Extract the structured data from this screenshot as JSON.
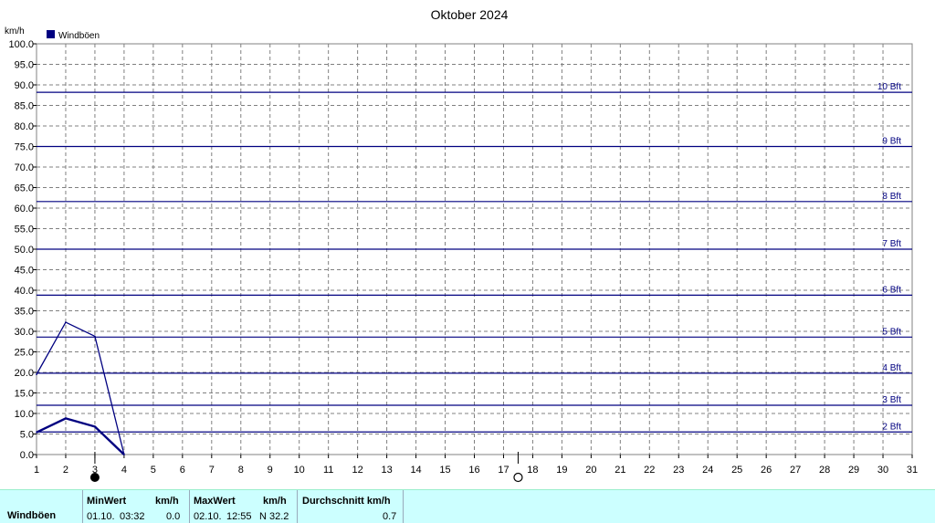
{
  "chart_data": {
    "type": "line",
    "title": "Oktober 2024",
    "ylabel": "km/h",
    "ylim": [
      0,
      100
    ],
    "yticks": [
      "0.0",
      "5.0",
      "10.0",
      "15.0",
      "20.0",
      "25.0",
      "30.0",
      "35.0",
      "40.0",
      "45.0",
      "50.0",
      "55.0",
      "60.0",
      "65.0",
      "70.0",
      "75.0",
      "80.0",
      "85.0",
      "90.0",
      "95.0",
      "100.0"
    ],
    "xlim": [
      1,
      31
    ],
    "xticks": [
      "1",
      "2",
      "3",
      "4",
      "5",
      "6",
      "7",
      "8",
      "9",
      "10",
      "11",
      "12",
      "13",
      "14",
      "15",
      "16",
      "17",
      "18",
      "19",
      "20",
      "21",
      "22",
      "23",
      "24",
      "25",
      "26",
      "27",
      "28",
      "29",
      "30",
      "31"
    ],
    "grid": true,
    "legend": "top-left",
    "series": [
      {
        "name": "Windböen",
        "role": "max",
        "color": "#000080",
        "x": [
          1,
          2,
          3,
          4
        ],
        "y": [
          19.5,
          32.2,
          28.8,
          0
        ]
      },
      {
        "role": "avg",
        "color": "#000080",
        "x": [
          1,
          2,
          3,
          4
        ],
        "y": [
          5.4,
          8.8,
          6.8,
          0
        ]
      }
    ],
    "beaufort": [
      {
        "label": "2 Bft",
        "value": 5.5
      },
      {
        "label": "3 Bft",
        "value": 12.0
      },
      {
        "label": "4 Bft",
        "value": 19.8
      },
      {
        "label": "5 Bft",
        "value": 28.6
      },
      {
        "label": "6 Bft",
        "value": 38.8
      },
      {
        "label": "7 Bft",
        "value": 50.0
      },
      {
        "label": "8 Bft",
        "value": 61.6
      },
      {
        "label": "9 Bft",
        "value": 75.0
      },
      {
        "label": "10 Bft",
        "value": 88.2
      }
    ],
    "moon_phases": [
      {
        "day": 3,
        "phase": "new-moon"
      },
      {
        "day": 17.5,
        "phase": "full-moon"
      }
    ]
  },
  "stats": {
    "row_label": "Windböen",
    "min_header": "MinWert",
    "min_unit": "km/h",
    "min_date": "01.10.",
    "min_time": "03:32",
    "min_value": "0.0",
    "max_header": "MaxWert",
    "max_unit": "km/h",
    "max_date": "02.10.",
    "max_time": "12:55",
    "max_value": "N 32.2",
    "avg_header": "Durchschnitt km/h",
    "avg_value": "0.7"
  }
}
